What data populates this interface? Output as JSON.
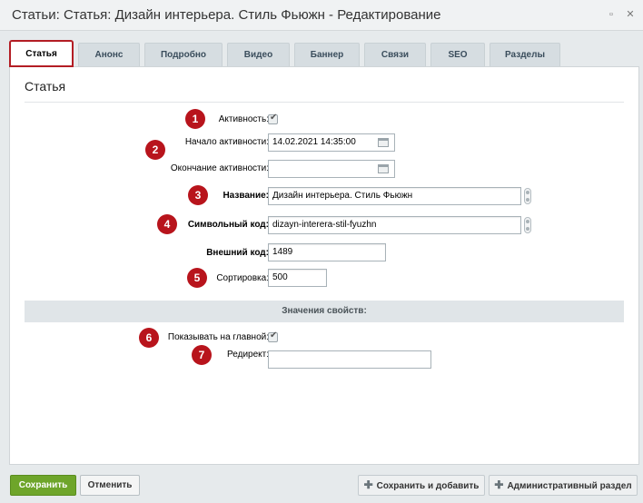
{
  "window": {
    "title": "Статьи: Статья: Дизайн интерьера. Стиль Фьюжн - Редактирование"
  },
  "tabs": [
    {
      "label": "Статья"
    },
    {
      "label": "Анонс"
    },
    {
      "label": "Подробно"
    },
    {
      "label": "Видео"
    },
    {
      "label": "Баннер"
    },
    {
      "label": "Связи"
    },
    {
      "label": "SEO"
    },
    {
      "label": "Разделы"
    }
  ],
  "section": {
    "title": "Статья"
  },
  "fields": {
    "active": {
      "label": "Активность:",
      "checked": true
    },
    "active_from": {
      "label": "Начало активности:",
      "value": "14.02.2021 14:35:00"
    },
    "active_to": {
      "label": "Окончание активности:",
      "value": ""
    },
    "name": {
      "label": "Название:",
      "value": "Дизайн интерьера. Стиль Фьюжн"
    },
    "code": {
      "label": "Символьный код:",
      "value": "dizayn-interera-stil-fyuzhn"
    },
    "xml_id": {
      "label": "Внешний код:",
      "value": "1489"
    },
    "sort": {
      "label": "Сортировка:",
      "value": "500"
    }
  },
  "properties": {
    "header": "Значения свойств:",
    "show_main": {
      "label": "Показывать на главной:",
      "checked": true
    },
    "redirect": {
      "label": "Редирект:",
      "value": ""
    }
  },
  "badges": [
    "1",
    "2",
    "3",
    "4",
    "5",
    "6",
    "7"
  ],
  "buttons": {
    "save": "Сохранить",
    "cancel": "Отменить",
    "save_add": "Сохранить и добавить",
    "admin_section": "Административный раздел"
  },
  "colors": {
    "accent": "#b8141c",
    "save_green": "#6ea52a"
  }
}
